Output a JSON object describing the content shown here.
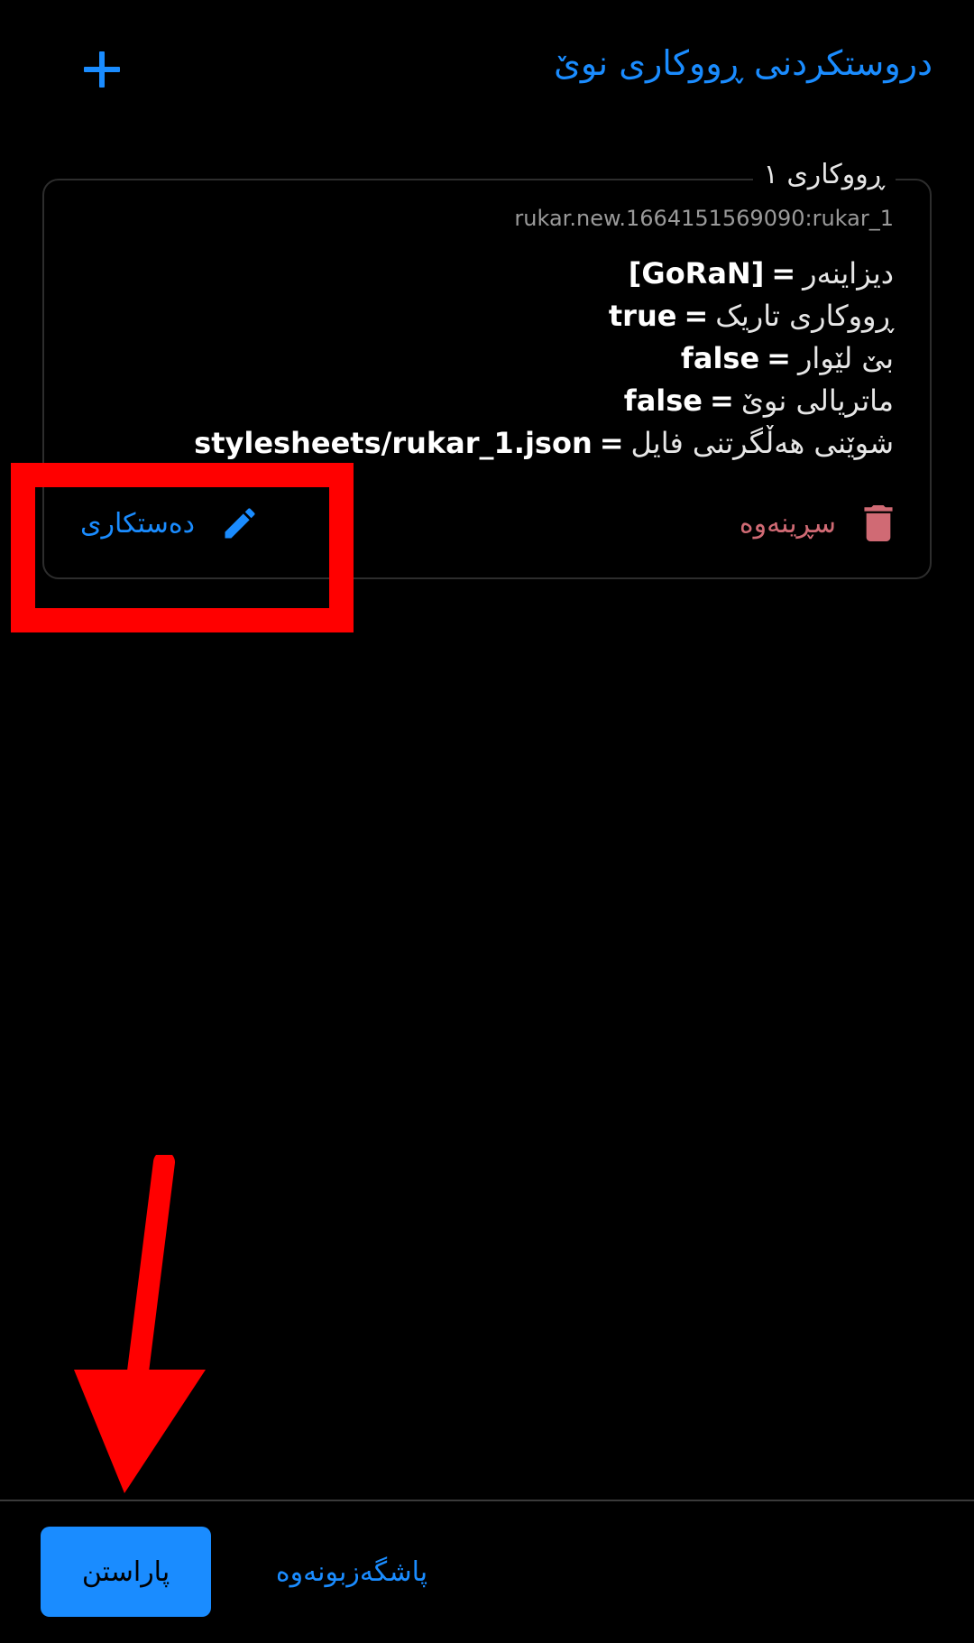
{
  "header": {
    "title": "دروستکردنی ڕووکاری نوێ",
    "add_icon": "plus-icon"
  },
  "card": {
    "legend": "ڕووکاری ١",
    "id": "rukar.new.1664151569090:rukar_1",
    "properties": [
      {
        "key": "دیزاینەر",
        "eq": "=",
        "value": "[GoRaN]"
      },
      {
        "key": "ڕووکاری تاریک",
        "eq": "=",
        "value": "true"
      },
      {
        "key": "بێ لێوار",
        "eq": "=",
        "value": "false"
      },
      {
        "key": "ماتریالی نوێ",
        "eq": "=",
        "value": "false"
      },
      {
        "key": "شوێنی هەڵگرتنی فایل",
        "eq": "=",
        "value": "stylesheets/rukar_1.json"
      }
    ],
    "edit_label": "دەستکاری",
    "edit_icon": "pencil-icon",
    "delete_label": "سڕینەوە",
    "delete_icon": "trash-icon"
  },
  "footer": {
    "confirm_label": "پاراستن",
    "cancel_label": "پاشگەزبونەوە"
  },
  "colors": {
    "accent": "#1a8cff",
    "danger": "#d06a74",
    "background": "#000000",
    "annotation": "#ff0000"
  }
}
